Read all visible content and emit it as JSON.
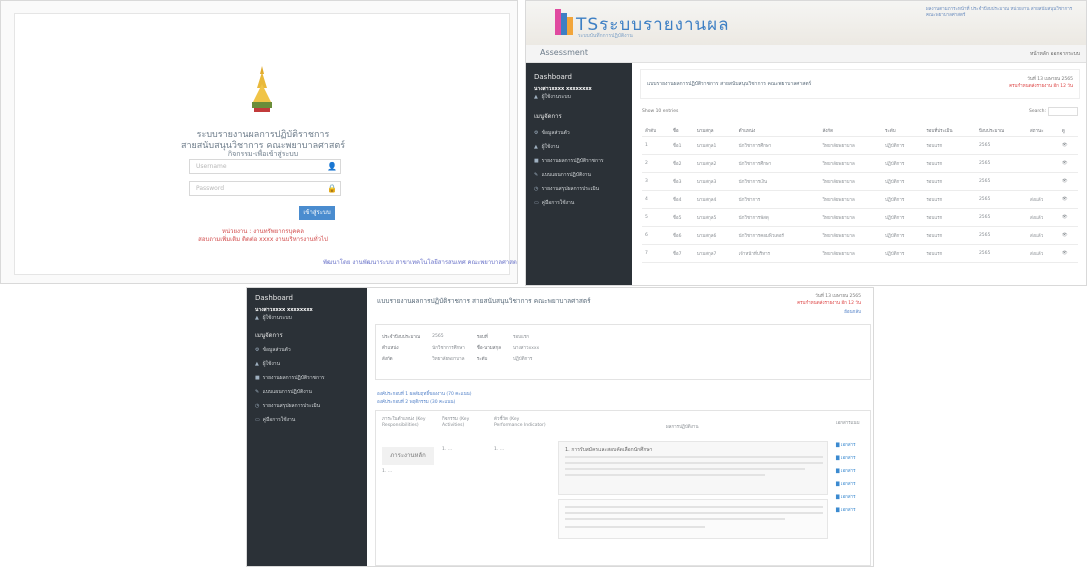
{
  "login": {
    "title": "ระบบรายงานผลการปฏิบัติราชการ\nสายสนับสนุนวิชาการ คณะพยาบาลศาสตร์",
    "subtitle": "กิจกรรม-เพื่อเข้าสู่ระบบ",
    "username_placeholder": "Username",
    "password_placeholder": "Password",
    "button": "เข้าสู่ระบบ",
    "note1": "หน่วยงาน : งานทรัพยากรบุคคล",
    "note2": "สอบถามเพิ่มเติม ติดต่อ xxxx งานบริหารงานทั่วไป",
    "footer": "พัฒนาโดย งานพัฒนาระบบ สาขาเทคโนโลยีสารสนเทศ คณะพยาบาลศาสตร์"
  },
  "panel2": {
    "brand": "TSระบบรายงานผล",
    "brand_small": "ระบบบันทึกการปฏิบัติงาน",
    "banner_note": "ผลงานตามภาระหน้าที่ ประจำปีงบประมาณ หน่วยงาน สายสนับสนุนวิชาการ คณะพยาบาลศาสตร์",
    "nav_title": "Assessment",
    "nav_right": "หน้าหลัก   ออกจากระบบ",
    "sidebar": {
      "dashboard": "Dashboard",
      "user": "นางสาวxxxx xxxxxxxx",
      "user_sub": "ผู้ใช้งานระบบ",
      "menu_head": "เมนูจัดการ",
      "items": [
        "ข้อมูลส่วนตัว",
        "ผู้ใช้งาน",
        "รายงานผลการปฏิบัติราชการ",
        "แบบแผนการปฏิบัติงาน",
        "รายงานสรุปผลการประเมิน",
        "คู่มือการใช้งาน"
      ]
    },
    "heading": "แบบรายงานผลการปฏิบัติราชการ สายสนับสนุนวิชาการ คณะพยาบาลศาสตร์",
    "heading_right_1": "วันที่ 13 เมษายน 2565",
    "heading_right_2": "ครบกำหนดส่งรายงาน อีก 12 วัน",
    "show_label": "Show 10 entries",
    "search_label": "Search:",
    "columns": [
      "ลำดับ",
      "ชื่อ",
      "นามสกุล",
      "ตำแหน่ง",
      "สังกัด",
      "ระดับ",
      "รอบที่ประเมิน",
      "ปีงบประมาณ",
      "สถานะ",
      "ดู"
    ],
    "rows": [
      [
        "1",
        "ชื่อ1",
        "นามสกุล1",
        "นักวิชาการศึกษา",
        "วิทยาลัยพยาบาล",
        "ปฏิบัติการ",
        "รอบแรก",
        "2565",
        "",
        "👁"
      ],
      [
        "2",
        "ชื่อ2",
        "นามสกุล2",
        "นักวิชาการศึกษา",
        "วิทยาลัยพยาบาล",
        "ปฏิบัติการ",
        "รอบแรก",
        "2565",
        "",
        "👁"
      ],
      [
        "3",
        "ชื่อ3",
        "นามสกุล3",
        "นักวิชาการเงิน",
        "วิทยาลัยพยาบาล",
        "ปฏิบัติการ",
        "รอบแรก",
        "2565",
        "",
        "👁"
      ],
      [
        "4",
        "ชื่อ4",
        "นามสกุล4",
        "นักวิชาการ",
        "วิทยาลัยพยาบาล",
        "ปฏิบัติการ",
        "รอบแรก",
        "2565",
        "ส่งแล้ว",
        "👁"
      ],
      [
        "5",
        "ชื่อ5",
        "นามสกุล5",
        "นักวิชาการพัสดุ",
        "วิทยาลัยพยาบาล",
        "ปฏิบัติการ",
        "รอบแรก",
        "2565",
        "ส่งแล้ว",
        "👁"
      ],
      [
        "6",
        "ชื่อ6",
        "นามสกุล6",
        "นักวิชาการคอมพิวเตอร์",
        "วิทยาลัยพยาบาล",
        "ปฏิบัติการ",
        "รอบแรก",
        "2565",
        "ส่งแล้ว",
        "👁"
      ],
      [
        "7",
        "ชื่อ7",
        "นามสกุล7",
        "เจ้าหน้าที่บริหาร",
        "วิทยาลัยพยาบาล",
        "ปฏิบัติการ",
        "รอบแรก",
        "2565",
        "ส่งแล้ว",
        "👁"
      ]
    ]
  },
  "panel3": {
    "heading": "แบบรายงานผลการปฏิบัติราชการ สายสนับสนุนวิชาการ คณะพยาบาลศาสตร์",
    "heading_right_1": "วันที่ 13 เมษายน 2565",
    "heading_right_2": "ครบกำหนดส่งรายงาน อีก 12 วัน",
    "back_link": "ย้อนกลับ",
    "info": [
      [
        "ประจำปีงบประมาณ",
        "2565",
        "รอบที่",
        "รอบแรก"
      ],
      [
        "ตำแหน่ง",
        "นักวิชาการศึกษา",
        "ชื่อ-นามสกุล",
        "นางสาวxxxx"
      ],
      [
        "สังกัด",
        "วิทยาลัยพยาบาล",
        "ระดับ",
        "ปฏิบัติการ"
      ]
    ],
    "section_link_1": "องค์ประกอบที่ 1 ผลสัมฤทธิ์ของงาน (70 คะแนน)",
    "section_link_2": "องค์ประกอบที่ 2 พฤติกรรม (30 คะแนน)",
    "col_headers": [
      "ภาระในตำแหน่ง (Key Responsibilities)",
      "กิจกรรม (Key Activities)",
      "ตัวชี้วัด (Key Performance Indicator)",
      "ผลการปฏิบัติงาน",
      "เอกสารแนบ"
    ],
    "key_title": "ภาระงานหลัก",
    "work_title": "1. การรับสมัครและสอบคัดเลือกนักศึกษา",
    "attach": "เอกสาร"
  }
}
